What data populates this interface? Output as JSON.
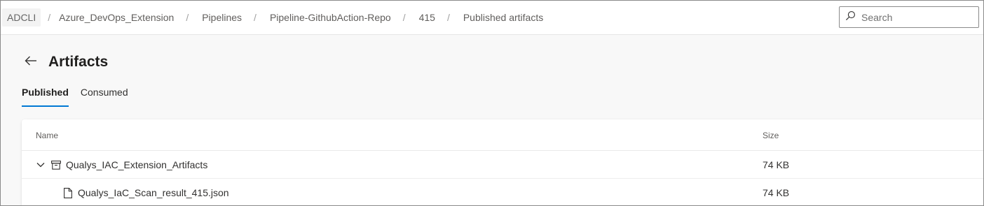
{
  "breadcrumb": {
    "items": [
      "ADCLI",
      "Azure_DevOps_Extension",
      "Pipelines",
      "Pipeline-GithubAction-Repo",
      "415",
      "Published artifacts"
    ],
    "separator": "/"
  },
  "search": {
    "placeholder": "Search"
  },
  "page": {
    "title": "Artifacts"
  },
  "tabs": [
    {
      "label": "Published",
      "selected": true
    },
    {
      "label": "Consumed",
      "selected": false
    }
  ],
  "table": {
    "columns": {
      "name": "Name",
      "size": "Size"
    },
    "rows": [
      {
        "name": "Qualys_IAC_Extension_Artifacts",
        "size": "74 KB",
        "type": "folder",
        "expanded": true
      },
      {
        "name": "Qualys_IaC_Scan_result_415.json",
        "size": "74 KB",
        "type": "file"
      }
    ]
  },
  "colors": {
    "accent": "#0078d4",
    "background": "#f8f8f8"
  },
  "icons": [
    "back-arrow-icon",
    "search-icon",
    "chevron-down-icon",
    "artifact-box-icon",
    "file-icon"
  ]
}
